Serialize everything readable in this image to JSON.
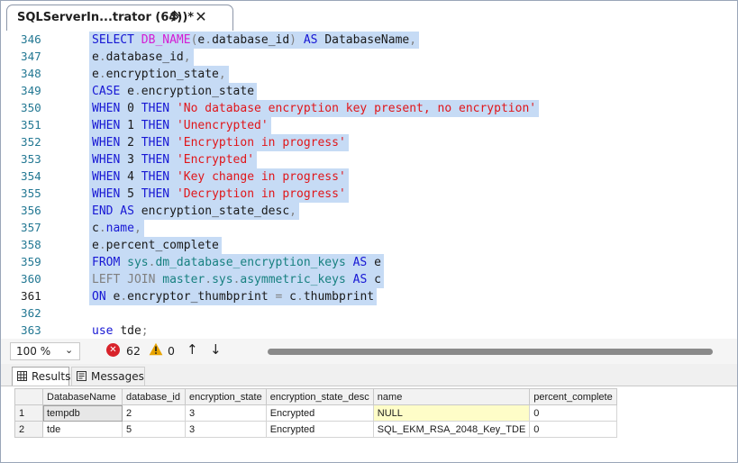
{
  "tab": {
    "title": "SQLServerIn...trator (64))*",
    "pin_icon": "pin-icon",
    "close_icon": "close-icon"
  },
  "editor": {
    "lines": [
      {
        "num": "346",
        "selected": true,
        "tokens": [
          [
            "k",
            "SELECT "
          ],
          [
            "f",
            "DB_NAME"
          ],
          [
            "g",
            "("
          ],
          [
            "",
            "e"
          ],
          [
            "g",
            "."
          ],
          [
            "",
            "database_id"
          ],
          [
            "g",
            ")"
          ],
          [
            "k",
            " AS "
          ],
          [
            "",
            "DatabaseName"
          ],
          [
            "g",
            ","
          ]
        ]
      },
      {
        "num": "347",
        "selected": true,
        "tokens": [
          [
            "",
            "e"
          ],
          [
            "g",
            "."
          ],
          [
            "",
            "database_id"
          ],
          [
            "g",
            ","
          ]
        ]
      },
      {
        "num": "348",
        "selected": true,
        "tokens": [
          [
            "",
            "e"
          ],
          [
            "g",
            "."
          ],
          [
            "",
            "encryption_state"
          ],
          [
            "g",
            ","
          ]
        ]
      },
      {
        "num": "349",
        "selected": true,
        "tokens": [
          [
            "k",
            "CASE "
          ],
          [
            "",
            "e"
          ],
          [
            "g",
            "."
          ],
          [
            "",
            "encryption_state"
          ]
        ]
      },
      {
        "num": "350",
        "selected": true,
        "tokens": [
          [
            "k",
            "WHEN "
          ],
          [
            "",
            "0"
          ],
          [
            "k",
            " THEN "
          ],
          [
            "s",
            "'No database encryption key present, no encryption'"
          ]
        ]
      },
      {
        "num": "351",
        "selected": true,
        "tokens": [
          [
            "k",
            "WHEN "
          ],
          [
            "",
            "1"
          ],
          [
            "k",
            " THEN "
          ],
          [
            "s",
            "'Unencrypted'"
          ]
        ]
      },
      {
        "num": "352",
        "selected": true,
        "tokens": [
          [
            "k",
            "WHEN "
          ],
          [
            "",
            "2"
          ],
          [
            "k",
            " THEN "
          ],
          [
            "s",
            "'Encryption in progress'"
          ]
        ]
      },
      {
        "num": "353",
        "selected": true,
        "tokens": [
          [
            "k",
            "WHEN "
          ],
          [
            "",
            "3"
          ],
          [
            "k",
            " THEN "
          ],
          [
            "s",
            "'Encrypted'"
          ]
        ]
      },
      {
        "num": "354",
        "selected": true,
        "tokens": [
          [
            "k",
            "WHEN "
          ],
          [
            "",
            "4"
          ],
          [
            "k",
            " THEN "
          ],
          [
            "s",
            "'Key change in progress'"
          ]
        ]
      },
      {
        "num": "355",
        "selected": true,
        "tokens": [
          [
            "k",
            "WHEN "
          ],
          [
            "",
            "5"
          ],
          [
            "k",
            " THEN "
          ],
          [
            "s",
            "'Decryption in progress'"
          ]
        ]
      },
      {
        "num": "356",
        "selected": true,
        "tokens": [
          [
            "k",
            "END AS "
          ],
          [
            "",
            "encryption_state_desc"
          ],
          [
            "g",
            ","
          ]
        ]
      },
      {
        "num": "357",
        "selected": true,
        "tokens": [
          [
            "",
            "c"
          ],
          [
            "g",
            "."
          ],
          [
            "k",
            "name"
          ],
          [
            "g",
            ","
          ]
        ]
      },
      {
        "num": "358",
        "selected": true,
        "tokens": [
          [
            "",
            "e"
          ],
          [
            "g",
            "."
          ],
          [
            "",
            "percent_complete"
          ]
        ]
      },
      {
        "num": "359",
        "selected": true,
        "tokens": [
          [
            "k",
            "FROM "
          ],
          [
            "t",
            "sys"
          ],
          [
            "g",
            "."
          ],
          [
            "t",
            "dm_database_encryption_keys"
          ],
          [
            "k",
            " AS "
          ],
          [
            "",
            "e"
          ]
        ]
      },
      {
        "num": "360",
        "selected": true,
        "tokens": [
          [
            "g",
            "LEFT JOIN "
          ],
          [
            "t",
            "master"
          ],
          [
            "g",
            "."
          ],
          [
            "t",
            "sys"
          ],
          [
            "g",
            "."
          ],
          [
            "t",
            "asymmetric_keys"
          ],
          [
            "k",
            " AS "
          ],
          [
            "",
            "c"
          ]
        ]
      },
      {
        "num": "361",
        "selected": true,
        "current": true,
        "tokens": [
          [
            "k",
            "ON "
          ],
          [
            "",
            "e"
          ],
          [
            "g",
            "."
          ],
          [
            "",
            "encryptor_thumbprint "
          ],
          [
            "g",
            "= "
          ],
          [
            "",
            "c"
          ],
          [
            "g",
            "."
          ],
          [
            "",
            "thumbprint"
          ]
        ]
      },
      {
        "num": "362",
        "selected": false,
        "tokens": []
      },
      {
        "num": "363",
        "selected": false,
        "tokens": [
          [
            "k",
            "use "
          ],
          [
            "",
            "tde"
          ],
          [
            "g",
            ";"
          ]
        ]
      }
    ]
  },
  "status": {
    "zoom": "100 %",
    "errors": "62",
    "warnings": "0",
    "error_icon": "error-icon",
    "warning_icon": "warning-icon"
  },
  "results_tabs": [
    {
      "label": "Results",
      "icon": "grid-icon"
    },
    {
      "label": "Messages",
      "icon": "messages-icon"
    }
  ],
  "grid": {
    "columns": [
      "DatabaseName",
      "database_id",
      "encryption_state",
      "encryption_state_desc",
      "name",
      "percent_complete"
    ],
    "rows": [
      {
        "num": "1",
        "cells": [
          "tempdb",
          "2",
          "3",
          "Encrypted",
          "NULL",
          "0"
        ]
      },
      {
        "num": "2",
        "cells": [
          "tde",
          "5",
          "3",
          "Encrypted",
          "SQL_EKM_RSA_2048_Key_TDE",
          "0"
        ]
      }
    ]
  }
}
